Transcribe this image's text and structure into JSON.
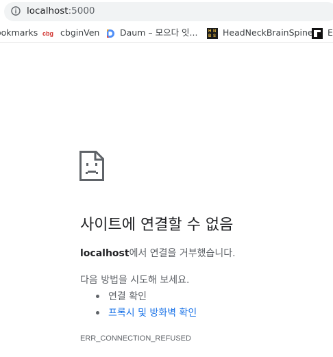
{
  "address_bar": {
    "host": "localhost",
    "port": ":5000"
  },
  "bookmarks": [
    {
      "label": "ookmarks",
      "icon": ""
    },
    {
      "label": "cbginVen",
      "icon": "cbg-logo"
    },
    {
      "label": "Daum – 모으다 잇...",
      "icon": "daum-logo"
    },
    {
      "label": "HeadNeckBrainSpine",
      "icon": "hnbs-logo"
    },
    {
      "label": "E",
      "icon": "e-logo"
    }
  ],
  "favicon_text": {
    "cbg": "cbg",
    "hnbs": [
      "H",
      "N",
      "B",
      "S"
    ]
  },
  "error": {
    "icon": "sad-page-icon",
    "title": "사이트에 연결할 수 없음",
    "host": "localhost",
    "desc_suffix": "에서 연결을 거부했습니다.",
    "try_text": "다음 방법을 시도해 보세요.",
    "suggestions": [
      "연결 확인",
      "프록시 및 방화벽 확인"
    ],
    "code": "ERR_CONNECTION_REFUSED"
  },
  "colors": {
    "link": "#1a73e8",
    "text_primary": "#202124",
    "text_secondary": "#5f6368",
    "omnibox_bg": "#f1f3f4"
  }
}
